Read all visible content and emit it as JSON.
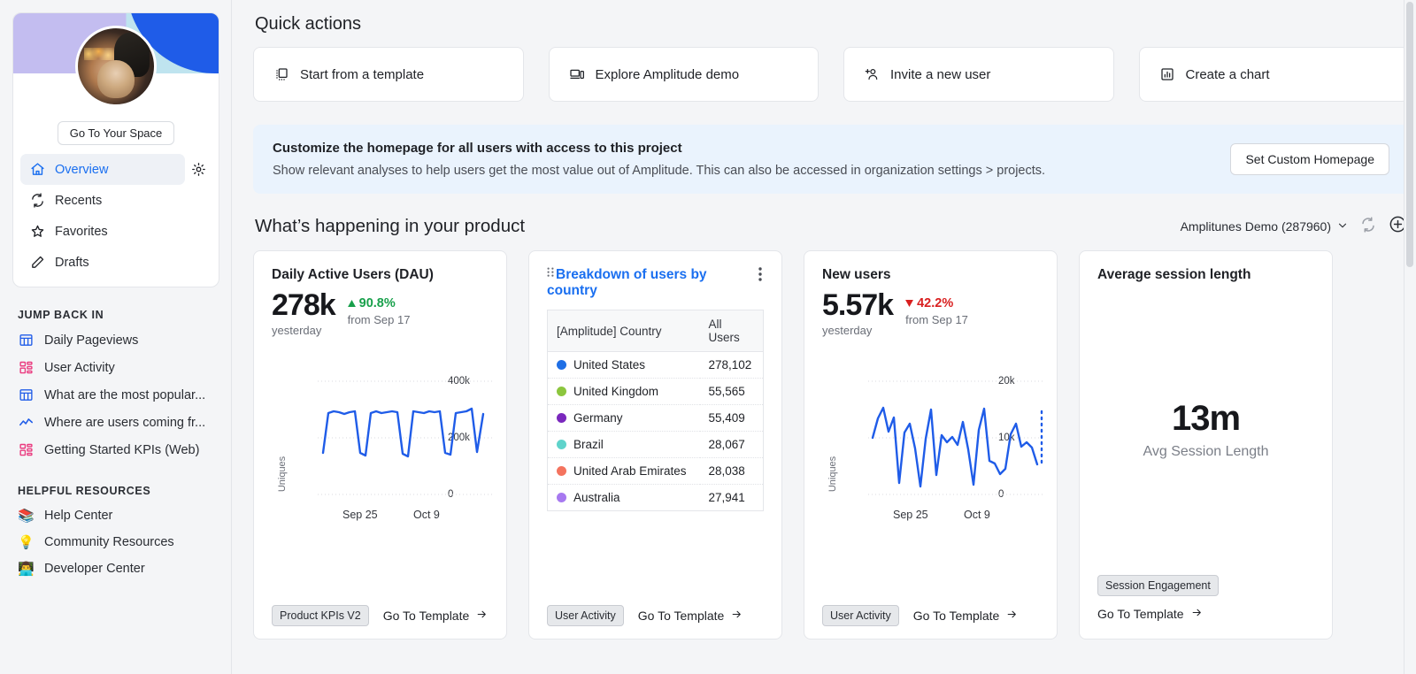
{
  "sidebar": {
    "space_button": "Go To Your Space",
    "nav": [
      {
        "label": "Overview",
        "icon": "home-icon",
        "active": true
      },
      {
        "label": "Recents",
        "icon": "refresh-icon",
        "active": false
      },
      {
        "label": "Favorites",
        "icon": "star-icon",
        "active": false
      },
      {
        "label": "Drafts",
        "icon": "pencil-icon",
        "active": false
      }
    ],
    "jump_back_in": {
      "label": "JUMP BACK IN",
      "items": [
        {
          "label": "Daily Pageviews",
          "icon": "table-chart-icon"
        },
        {
          "label": "User Activity",
          "icon": "dashboard-grid-icon"
        },
        {
          "label": "What are the most popular...",
          "icon": "table-chart-icon"
        },
        {
          "label": "Where are users coming fr...",
          "icon": "line-chart-icon"
        },
        {
          "label": "Getting Started KPIs (Web)",
          "icon": "dashboard-grid-icon"
        }
      ]
    },
    "helpful_resources": {
      "label": "HELPFUL RESOURCES",
      "items": [
        {
          "label": "Help Center",
          "icon": "books-icon",
          "emoji": "📚"
        },
        {
          "label": "Community Resources",
          "icon": "lightbulb-icon",
          "emoji": "💡"
        },
        {
          "label": "Developer Center",
          "icon": "technologist-icon",
          "emoji": "👨‍💻"
        }
      ]
    }
  },
  "quick_actions": {
    "title": "Quick actions",
    "items": [
      {
        "label": "Start from a template",
        "icon": "template-icon"
      },
      {
        "label": "Explore Amplitude demo",
        "icon": "devices-icon"
      },
      {
        "label": "Invite a new user",
        "icon": "add-user-icon"
      },
      {
        "label": "Create a chart",
        "icon": "bar-chart-icon"
      }
    ]
  },
  "banner": {
    "title": "Customize the homepage for all users with access to this project",
    "subtitle": "Show relevant analyses to help users get the most value out of Amplitude. This can also be accessed in organization settings > projects.",
    "button": "Set Custom Homepage"
  },
  "happening": {
    "title": "What’s happening in your product",
    "project": "Amplitunes Demo (287960)",
    "refresh_icon": "refresh-icon",
    "add_icon": "plus-circle-icon"
  },
  "cards": [
    {
      "title": "Daily Active Users (DAU)",
      "is_link": false,
      "metric": "278k",
      "metric_sub": "yesterday",
      "delta": "90.8%",
      "delta_dir": "up",
      "delta_sub": "from Sep 17",
      "chip": "Product KPIs V2",
      "goto": "Go To Template"
    },
    {
      "title": "Breakdown of users by country",
      "is_link": true,
      "columns": [
        "[Amplitude] Country",
        "All Users"
      ],
      "rows": [
        {
          "country": "United States",
          "value": "278,102",
          "color": "#1f6fe5"
        },
        {
          "country": "United Kingdom",
          "value": "55,565",
          "color": "#8cc63e"
        },
        {
          "country": "Germany",
          "value": "55,409",
          "color": "#7a28bd"
        },
        {
          "country": "Brazil",
          "value": "28,067",
          "color": "#5fd3cb"
        },
        {
          "country": "United Arab Emirates",
          "value": "28,038",
          "color": "#f4735e"
        },
        {
          "country": "Australia",
          "value": "27,941",
          "color": "#a779f0"
        }
      ],
      "chip": "User Activity",
      "goto": "Go To Template"
    },
    {
      "title": "New users",
      "is_link": false,
      "metric": "5.57k",
      "metric_sub": "yesterday",
      "delta": "42.2%",
      "delta_dir": "down",
      "delta_sub": "from Sep 17",
      "chip": "User Activity",
      "goto": "Go To Template"
    },
    {
      "title": "Average session length",
      "is_link": false,
      "metric": "13m",
      "metric_sub": "Avg Session Length",
      "chip": "Session Engagement",
      "goto": "Go To Template"
    }
  ],
  "chart_data": [
    {
      "type": "line",
      "title": "Daily Active Users (DAU)",
      "xlabel": "",
      "ylabel": "Uniques",
      "ylim": [
        0,
        400000
      ],
      "yticks": [
        "0",
        "200k",
        "400k"
      ],
      "xticks": [
        "Sep 25",
        "Oct 9"
      ],
      "grid": true,
      "legend": "none",
      "color": "#1f5ce8",
      "x": [
        1,
        2,
        3,
        4,
        5,
        6,
        7,
        8,
        9,
        10,
        11,
        12,
        13,
        14,
        15,
        16,
        17,
        18,
        19,
        20,
        21,
        22,
        23,
        24,
        25,
        26,
        27,
        28,
        29,
        30,
        31
      ],
      "values": [
        148000,
        286000,
        292000,
        290000,
        283000,
        288000,
        290000,
        148000,
        139000,
        286000,
        290000,
        285000,
        288000,
        291000,
        288000,
        145000,
        140000,
        291000,
        288000,
        286000,
        290000,
        288000,
        290000,
        147000,
        141000,
        285000,
        288000,
        290000,
        296000,
        150000,
        278000
      ]
    },
    {
      "type": "line",
      "title": "New users",
      "xlabel": "",
      "ylabel": "Uniques",
      "ylim": [
        0,
        20000
      ],
      "yticks": [
        "0",
        "10k",
        "20k"
      ],
      "xticks": [
        "Sep 25",
        "Oct 9"
      ],
      "grid": true,
      "legend": "none",
      "color": "#1f5ce8",
      "x": [
        1,
        2,
        3,
        4,
        5,
        6,
        7,
        8,
        9,
        10,
        11,
        12,
        13,
        14,
        15,
        16,
        17,
        18,
        19,
        20,
        21,
        22,
        23,
        24,
        25,
        26,
        27,
        28,
        29,
        30,
        31,
        32
      ],
      "values": [
        9900,
        13200,
        15400,
        11100,
        13600,
        2100,
        10900,
        12600,
        8200,
        1500,
        9800,
        15000,
        3500,
        10300,
        9200,
        10100,
        8800,
        12300,
        8000,
        1800,
        11400,
        15100,
        6800,
        6500,
        4000,
        5200,
        10700,
        12600,
        8400,
        9100,
        8100,
        6200
      ]
    },
    {
      "type": "scalar",
      "title": "Average session length",
      "value": "13m",
      "label": "Avg Session Length"
    }
  ]
}
